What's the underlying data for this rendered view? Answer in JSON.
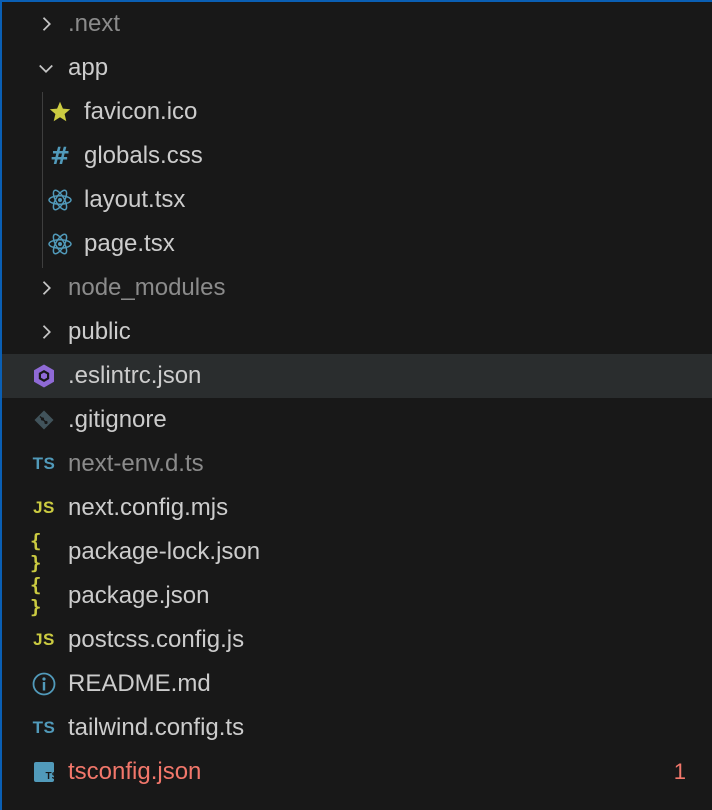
{
  "explorer": {
    "items": [
      {
        "label": ".next",
        "type": "folder",
        "state": "collapsed",
        "dim": true
      },
      {
        "label": "app",
        "type": "folder",
        "state": "expanded"
      },
      {
        "label": "favicon.ico",
        "icon": "star-icon"
      },
      {
        "label": "globals.css",
        "icon": "hash-icon"
      },
      {
        "label": "layout.tsx",
        "icon": "react-icon"
      },
      {
        "label": "page.tsx",
        "icon": "react-icon"
      },
      {
        "label": "node_modules",
        "type": "folder",
        "state": "collapsed",
        "dim": true
      },
      {
        "label": "public",
        "type": "folder",
        "state": "collapsed"
      },
      {
        "label": ".eslintrc.json",
        "icon": "eslint-icon",
        "selected": true
      },
      {
        "label": ".gitignore",
        "icon": "git-icon"
      },
      {
        "label": "next-env.d.ts",
        "icon": "typescript-icon",
        "icon_text": "TS",
        "dim": true
      },
      {
        "label": "next.config.mjs",
        "icon": "javascript-icon",
        "icon_text": "JS"
      },
      {
        "label": "package-lock.json",
        "icon": "json-icon",
        "icon_text": "{ }"
      },
      {
        "label": "package.json",
        "icon": "json-icon",
        "icon_text": "{ }"
      },
      {
        "label": "postcss.config.js",
        "icon": "javascript-icon",
        "icon_text": "JS"
      },
      {
        "label": "README.md",
        "icon": "info-icon"
      },
      {
        "label": "tailwind.config.ts",
        "icon": "typescript-icon",
        "icon_text": "TS"
      },
      {
        "label": "tsconfig.json",
        "icon": "tsconfig-icon",
        "icon_text": "TS",
        "error": true,
        "badge": "1"
      }
    ]
  },
  "colors": {
    "background": "#181818",
    "selected_row": "#2a2d2e",
    "text": "#cccccc",
    "dim_text": "#8b8b8b",
    "error": "#f2776b",
    "focus_border": "#0a5fb4",
    "typescript": "#519aba",
    "javascript": "#cbcb41",
    "eslint": "#8f6ad6"
  }
}
